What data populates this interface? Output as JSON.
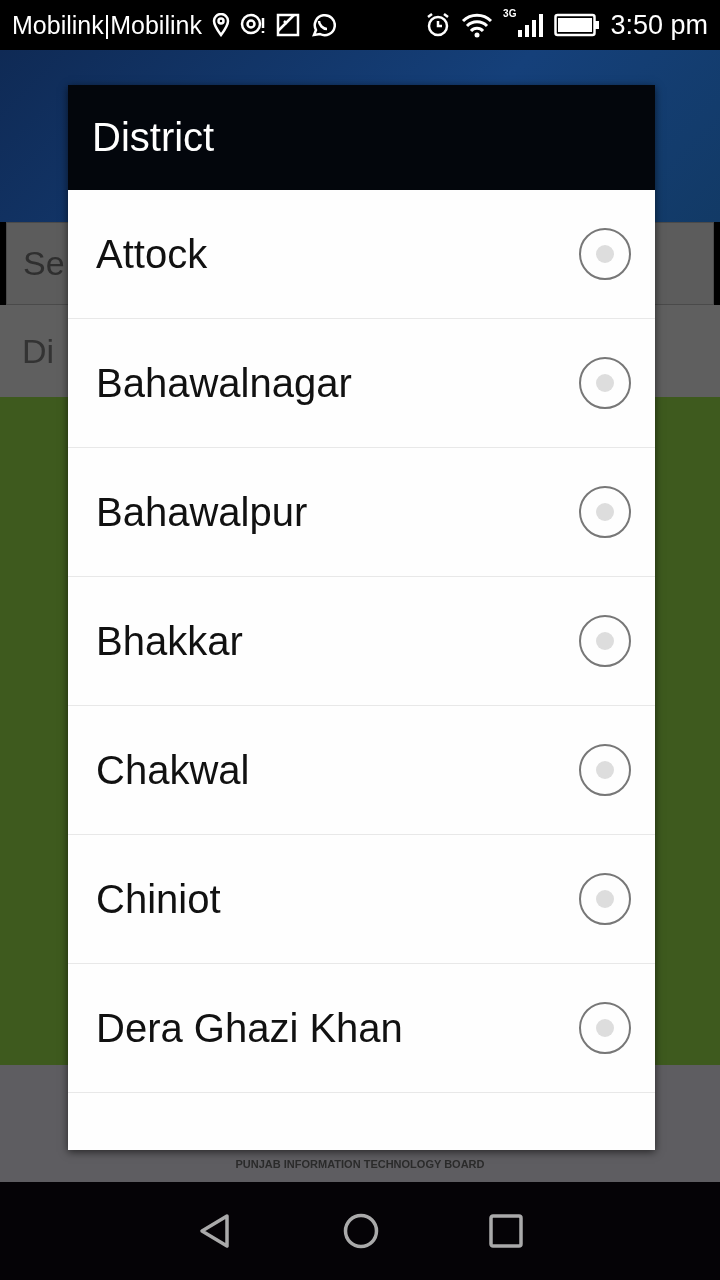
{
  "status_bar": {
    "carrier": "Mobilink|Mobilink",
    "network": "3G",
    "time": "3:50 pm"
  },
  "background": {
    "search_placeholder": "Se",
    "district_label": "Di",
    "footer": "PUNJAB INFORMATION TECHNOLOGY BOARD"
  },
  "dialog": {
    "title": "District",
    "options": [
      {
        "label": "Attock",
        "selected": false
      },
      {
        "label": "Bahawalnagar",
        "selected": false
      },
      {
        "label": "Bahawalpur",
        "selected": false
      },
      {
        "label": "Bhakkar",
        "selected": false
      },
      {
        "label": "Chakwal",
        "selected": false
      },
      {
        "label": "Chiniot",
        "selected": false
      },
      {
        "label": "Dera Ghazi Khan",
        "selected": false
      }
    ]
  }
}
